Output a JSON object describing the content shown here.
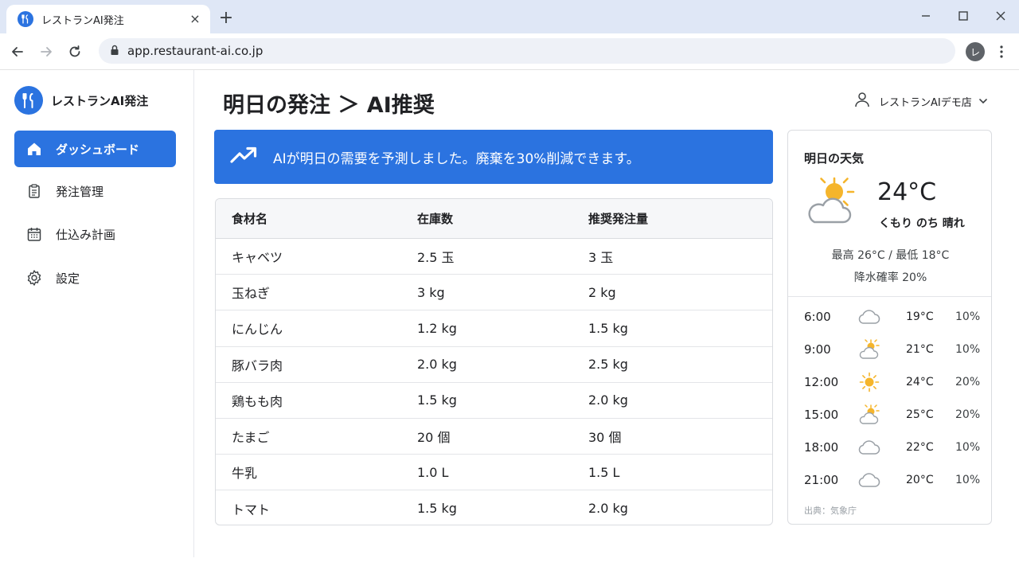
{
  "browser": {
    "tab_title": "レストランAI発注",
    "tab_close": "×",
    "new_tab": "+",
    "url": "app.restaurant-ai.co.jp",
    "profile_initial": "レ"
  },
  "sidebar": {
    "brand": "レストランAI発注",
    "items": [
      {
        "label": "ダッシュボード",
        "icon": "home-icon",
        "active": true
      },
      {
        "label": "発注管理",
        "icon": "clipboard-icon",
        "active": false
      },
      {
        "label": "仕込み計画",
        "icon": "calendar-icon",
        "active": false
      },
      {
        "label": "設定",
        "icon": "gear-icon",
        "active": false
      }
    ]
  },
  "header": {
    "title": "明日の発注 ＞ AI推奨",
    "user": "レストランAIデモ店"
  },
  "banner": {
    "text": "AIが明日の需要を予測しました。廃棄を30%削減できます。",
    "icon": "trending-up-icon"
  },
  "table": {
    "columns": [
      "食材名",
      "在庫数",
      "推奨発注量"
    ],
    "rows": [
      [
        "キャベツ",
        "2.5 玉",
        "3 玉"
      ],
      [
        "玉ねぎ",
        "3 kg",
        "2 kg"
      ],
      [
        "にんじん",
        "1.2 kg",
        "1.5 kg"
      ],
      [
        "豚バラ肉",
        "2.0 kg",
        "2.5 kg"
      ],
      [
        "鶏もも肉",
        "1.5 kg",
        "2.0 kg"
      ],
      [
        "たまご",
        "20 個",
        "30 個"
      ],
      [
        "牛乳",
        "1.0 L",
        "1.5 L"
      ],
      [
        "トマト",
        "1.5 kg",
        "2.0 kg"
      ]
    ]
  },
  "weather": {
    "title": "明日の天気",
    "temp": "24°C",
    "condition": "くもり のち 晴れ",
    "hilo": "最高 26°C / 最低 18°C",
    "rain": "降水確率 20%",
    "hourly": [
      {
        "time": "6:00",
        "icon": "cloud-icon",
        "temp": "19°C",
        "rain": "10%"
      },
      {
        "time": "9:00",
        "icon": "sun-cloud-icon",
        "temp": "21°C",
        "rain": "10%"
      },
      {
        "time": "12:00",
        "icon": "sun-icon",
        "temp": "24°C",
        "rain": "20%"
      },
      {
        "time": "15:00",
        "icon": "sun-cloud-icon",
        "temp": "25°C",
        "rain": "20%"
      },
      {
        "time": "18:00",
        "icon": "cloud-icon",
        "temp": "22°C",
        "rain": "10%"
      },
      {
        "time": "21:00",
        "icon": "cloud-icon",
        "temp": "20°C",
        "rain": "10%"
      }
    ],
    "source": "出典：気象庁"
  },
  "colors": {
    "accent": "#2b73e0",
    "sun": "#f5b52c",
    "cloud_stroke": "#9aa0a6"
  }
}
